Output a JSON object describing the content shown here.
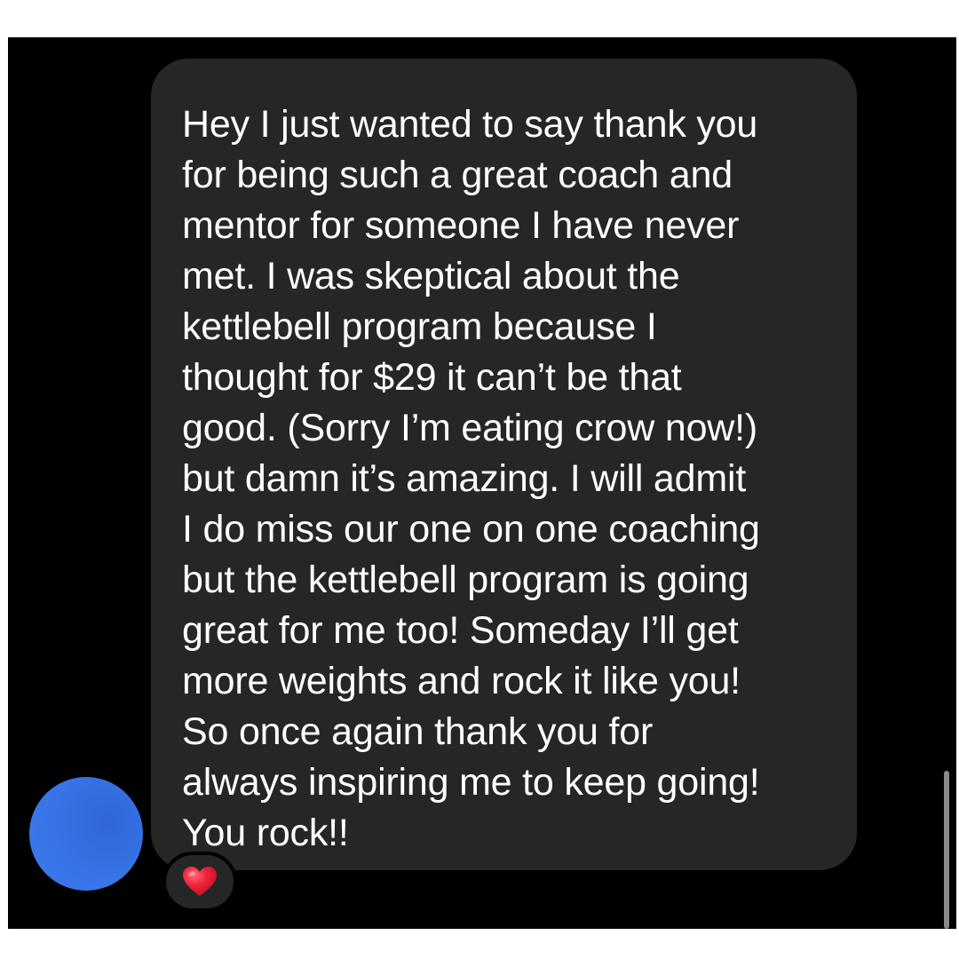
{
  "message": {
    "text": "Hey I just wanted to say thank you\nfor being such a great coach and\nmentor for someone I have never\nmet. I was skeptical about the\nkettlebell program because I\nthought for $29 it can’t be that\ngood. (Sorry I’m eating crow now!)\nbut damn it’s amazing. I will admit\nI do miss our one on one coaching\nbut the kettlebell program is going\ngreat for me too! Someday I’ll get\nmore weights and rock it like you!\nSo once again thank you for\nalways inspiring me to keep going!\nYou rock!!",
    "reaction_icon": "red-heart-icon"
  },
  "sender": {
    "avatar_icon": "avatar",
    "avatar_color": "#3774e6"
  },
  "colors": {
    "background": "#000000",
    "bubble": "#262626",
    "text": "#ffffff",
    "heart": "#e8112d"
  }
}
